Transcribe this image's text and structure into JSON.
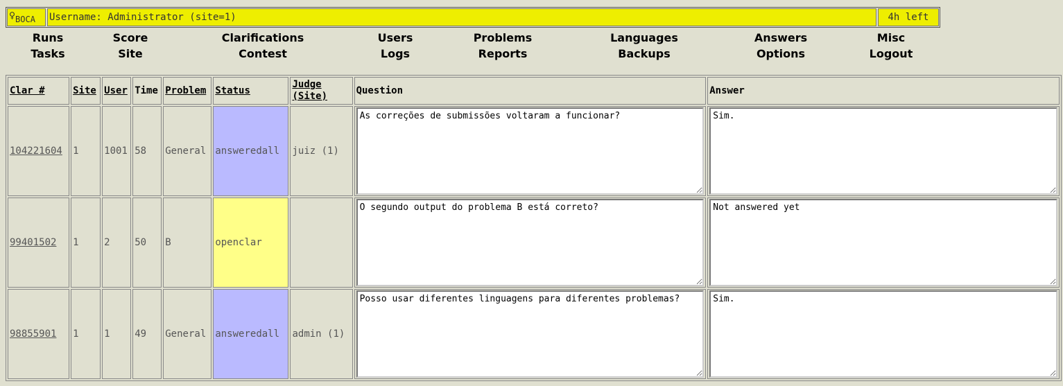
{
  "header": {
    "logo_text": "BOCA",
    "username": "Username: Administrator (site=1)",
    "time_left": "4h left"
  },
  "menu": {
    "row1": [
      "Runs",
      "Score",
      "Clarifications",
      "Users",
      "Problems",
      "Languages",
      "Answers",
      "Misc"
    ],
    "row2": [
      "Tasks",
      "Site",
      "Contest",
      "Logs",
      "Reports",
      "Backups",
      "Options",
      "Logout"
    ]
  },
  "table": {
    "headers": {
      "clar": "Clar #",
      "site": "Site",
      "user": "User",
      "time": "Time",
      "problem": "Problem",
      "status": "Status",
      "judge_line1": "Judge",
      "judge_line2": "(Site)",
      "question": "Question",
      "answer": "Answer"
    },
    "rows": [
      {
        "clar": "104221604",
        "site": "1",
        "user": "1001",
        "time": "58",
        "problem": "General",
        "status": "answeredall",
        "judge": "juiz (1)",
        "question": "As correções de submissões voltaram a funcionar?",
        "answer": "Sim."
      },
      {
        "clar": "99401502",
        "site": "1",
        "user": "2",
        "time": "50",
        "problem": "B",
        "status": "openclar",
        "judge": "",
        "question": "O segundo output do problema B está correto?",
        "answer": "Not answered yet"
      },
      {
        "clar": "98855901",
        "site": "1",
        "user": "1",
        "time": "49",
        "problem": "General",
        "status": "answeredall",
        "judge": "admin (1)",
        "question": "Posso usar diferentes linguagens para diferentes problemas?",
        "answer": "Sim."
      }
    ]
  },
  "colors": {
    "page_bg": "#e0e0d0",
    "header_yellow": "#eeee00",
    "status_answered": "#babaff",
    "status_open": "#ffff88"
  }
}
